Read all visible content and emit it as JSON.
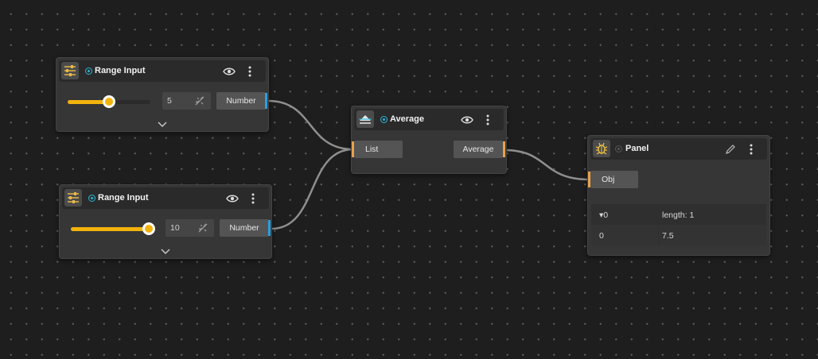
{
  "nodes": {
    "range1": {
      "title": "Range Input",
      "value": "5",
      "output": "Number",
      "slider_fraction": 0.5
    },
    "range2": {
      "title": "Range Input",
      "value": "10",
      "output": "Number",
      "slider_fraction": 1.0
    },
    "average": {
      "title": "Average",
      "input": "List",
      "output": "Average"
    },
    "panel": {
      "title": "Panel",
      "input": "Obj",
      "rows": [
        {
          "key": "0",
          "value": "length: 1",
          "expander": "▾"
        },
        {
          "key": "0",
          "value": "7.5"
        }
      ]
    }
  },
  "colors": {
    "accent": "#29b6d8",
    "slider": "#f2b30c",
    "output_pin": "#2aa0e0",
    "input_pin": "#e8a24c",
    "wire": "#8f8f8f"
  }
}
